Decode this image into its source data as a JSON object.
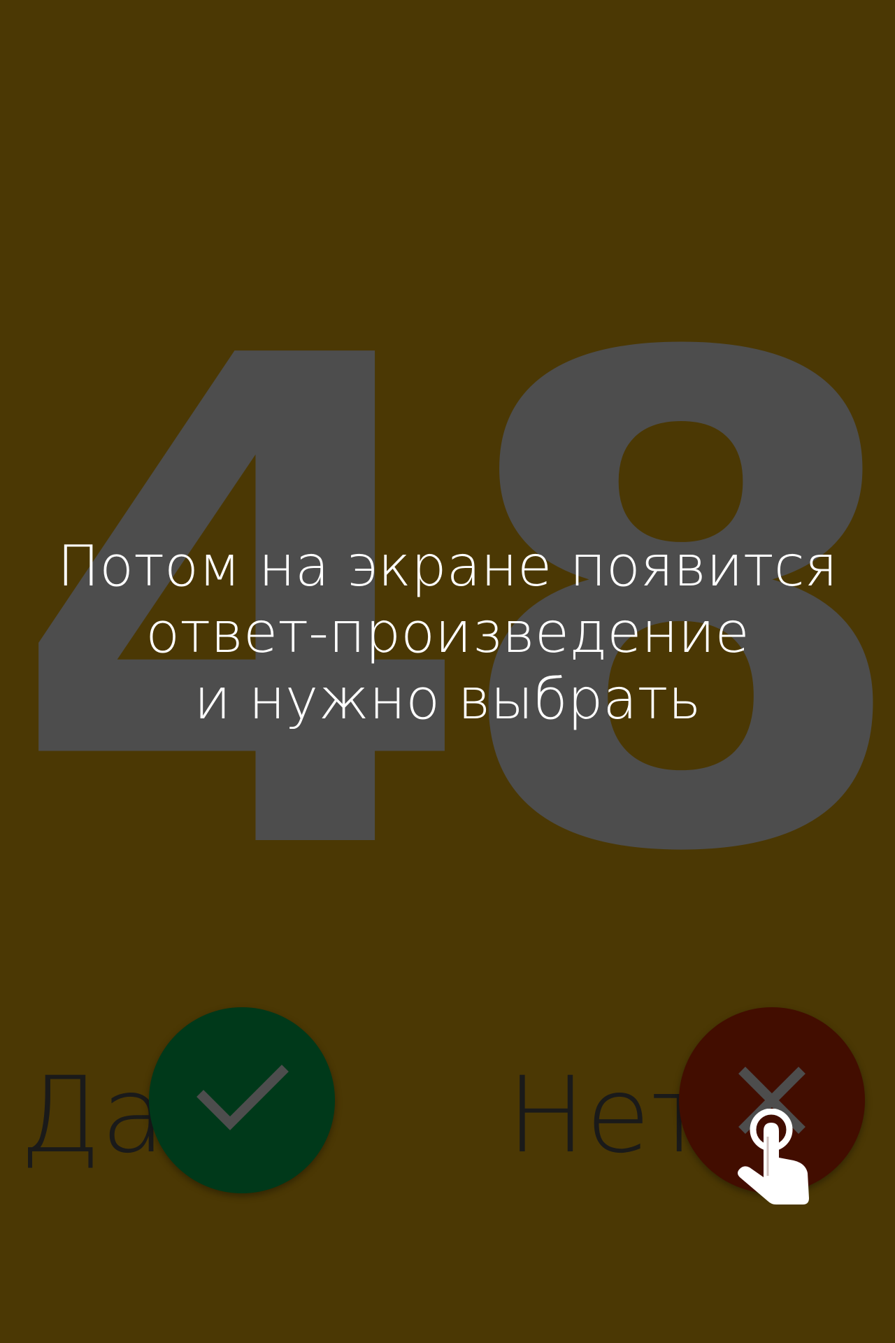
{
  "background_color": "#4b3804",
  "big_number": "48",
  "hint": {
    "line1": "Потом на экране появится",
    "line2": "ответ-произведение",
    "line3": "и нужно выбрать"
  },
  "answers": {
    "yes": {
      "label": "Да",
      "icon": "checkmark-icon",
      "color": "#00391a"
    },
    "no": {
      "label": "Нет",
      "icon": "close-icon",
      "color": "#420d00"
    }
  },
  "pointer_icon": "tap-hand-icon"
}
